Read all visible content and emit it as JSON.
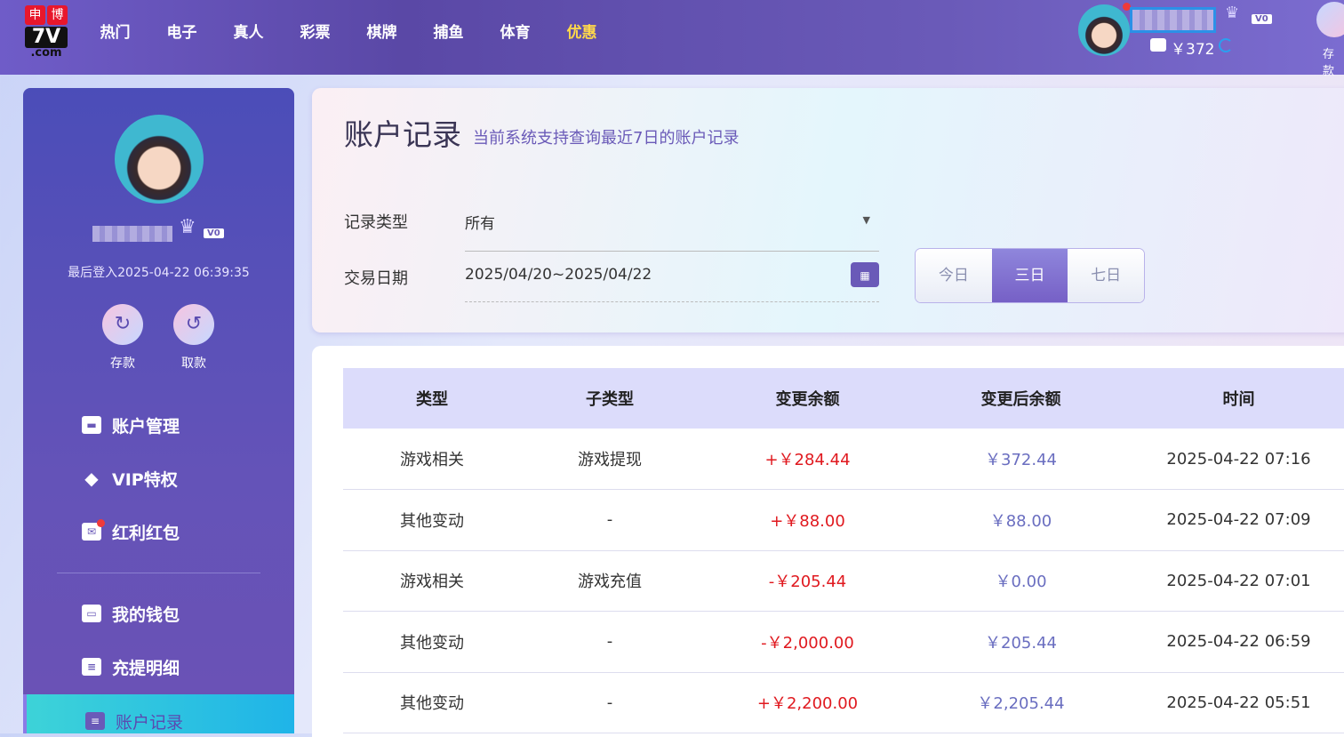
{
  "header": {
    "logo": {
      "line1": [
        "申",
        "博"
      ],
      "line2": "7V",
      "line3": ".com"
    },
    "nav": [
      "热门",
      "电子",
      "真人",
      "彩票",
      "棋牌",
      "捕鱼",
      "体育",
      "优惠"
    ],
    "balance": "￥372",
    "vip": "V0",
    "deposit_label": "存款"
  },
  "sidebar": {
    "vip": "V0",
    "last_login": "最后登入2025-04-22 06:39:35",
    "quick": [
      {
        "label": "存款"
      },
      {
        "label": "取款"
      }
    ],
    "items": [
      {
        "label": "账户管理"
      },
      {
        "label": "VIP特权"
      },
      {
        "label": "红利红包"
      },
      {
        "label": "我的钱包"
      },
      {
        "label": "充提明细"
      },
      {
        "label": "账户记录"
      }
    ]
  },
  "filter": {
    "title": "账户记录",
    "subtitle": "当前系统支持查询最近7日的账户记录",
    "type_label": "记录类型",
    "type_value": "所有",
    "date_label": "交易日期",
    "date_value": "2025/04/20~2025/04/22",
    "ranges": [
      "今日",
      "三日",
      "七日"
    ],
    "selected_range": "三日"
  },
  "table": {
    "columns": [
      "类型",
      "子类型",
      "变更余额",
      "变更后余额",
      "时间"
    ],
    "rows": [
      [
        "游戏相关",
        "游戏提现",
        "+￥284.44",
        "￥372.44",
        "2025-04-22 07:16"
      ],
      [
        "其他变动",
        "-",
        "+￥88.00",
        "￥88.00",
        "2025-04-22 07:09"
      ],
      [
        "游戏相关",
        "游戏充值",
        "-￥205.44",
        "￥0.00",
        "2025-04-22 07:01"
      ],
      [
        "其他变动",
        "-",
        "-￥2,000.00",
        "￥205.44",
        "2025-04-22 06:59"
      ],
      [
        "其他变动",
        "-",
        "+￥2,200.00",
        "￥2,205.44",
        "2025-04-22 05:51"
      ]
    ]
  },
  "colors": {
    "accent": "#6a5ab8",
    "amount": "#e0191f",
    "balance": "#6a6ec0",
    "promo": "#ffd84a"
  }
}
